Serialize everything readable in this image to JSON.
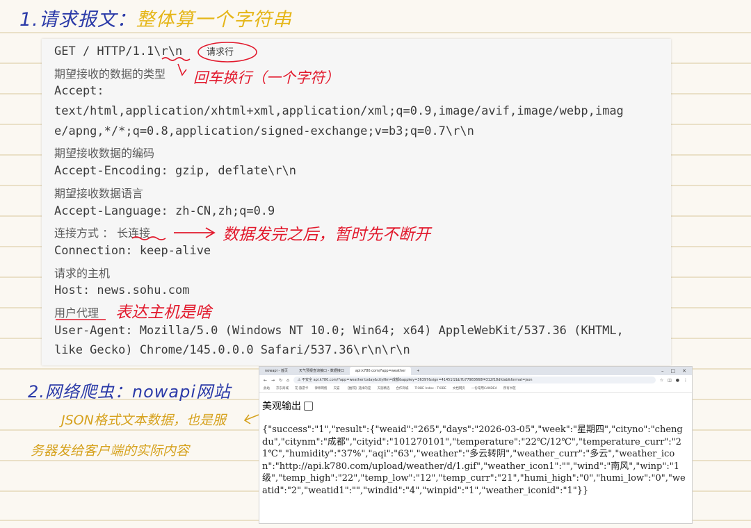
{
  "notes": {
    "title1_prefix": "1.请求报文：",
    "title1_accent": "整体算一个字符串",
    "annotation_request_line": "请求行",
    "annotation_crlf": "回车换行（一个字符）",
    "annotation_keepalive": "数据发完之后，暂时先不断开",
    "annotation_useragent": "表达主机是啥",
    "title2": "2.网络爬虫：nowapi网站",
    "gold_line1": "JSON格式文本数据，也是服",
    "gold_line2": "务器发给客户端的实际内容"
  },
  "http": {
    "request_line": "GET / HTTP/1.1\\r\\n",
    "cm_accept": "期望接收的数据的类型",
    "accept_key": "Accept:",
    "accept_value_1": "text/html,application/xhtml+xml,application/xml;q=0.9,image/avif,image/webp,imag",
    "accept_value_2": "e/apng,*/*;q=0.8,application/signed-exchange;v=b3;q=0.7\\r\\n",
    "cm_encoding": "期望接收数据的编码",
    "accept_encoding": "Accept-Encoding: gzip, deflate\\r\\n",
    "cm_language": "期望接收数据语言",
    "accept_language": "Accept-Language: zh-CN,zh;q=0.9",
    "cm_connection": "连接方式 ： 长连接",
    "connection": "Connection: keep-alive",
    "cm_host": "请求的主机",
    "host": "Host: news.sohu.com",
    "cm_useragent": "用户代理",
    "user_agent_1": "User-Agent: Mozilla/5.0 (Windows NT 10.0; Win64; x64) AppleWebKit/537.36 (KHTML,",
    "user_agent_2": "like Gecko) Chrome/145.0.0.0 Safari/537.36\\r\\n\\r\\n"
  },
  "browser": {
    "tabs": [
      "nowapi - 首页",
      "天气预报查询接口 - 数据接口",
      "api.k780.com/?app=weather"
    ],
    "new_tab": "+",
    "url": "api.k780.com/?app=weather.today&cityNm=成都&appkey=36397&sign=41451f2bb7b77983668f4312f18dfdab&format=json",
    "url_security": "不安全",
    "bookmarks": [
      "此站",
      "京东商城",
      "花·旅游卡",
      "律师网络",
      "天猫",
      "【推荐】选择的是",
      "天涯精选",
      "合作商城",
      "TIOBE Index - TIOBE",
      "文档网页",
      "一份常用CANDEA",
      "所有书签"
    ],
    "pretty_label": "美观输出",
    "json_text": "{\"success\":\"1\",\"result\":{\"weaid\":\"265\",\"days\":\"2026-03-05\",\"week\":\"星期四\",\"cityno\":\"chengdu\",\"citynm\":\"成都\",\"cityid\":\"101270101\",\"temperature\":\"22℃/12℃\",\"temperature_curr\":\"21℃\",\"humidity\":\"37%\",\"aqi\":\"63\",\"weather\":\"多云转阴\",\"weather_curr\":\"多云\",\"weather_icon\":\"http://api.k780.com/upload/weather/d/1.gif\",\"weather_icon1\":\"\",\"wind\":\"南风\",\"winp\":\"1级\",\"temp_high\":\"22\",\"temp_low\":\"12\",\"temp_curr\":\"21\",\"humi_high\":\"0\",\"humi_low\":\"0\",\"weatid\":\"2\",\"weatid1\":\"\",\"windid\":\"4\",\"winpid\":\"1\",\"weather_iconid\":\"1\"}}"
  },
  "colors": {
    "paper": "#fbf8f2",
    "rule": "#d9c79c",
    "blue_ink": "#2b3aa8",
    "red_ink": "#e2192c",
    "gold_ink": "#d6a21e"
  }
}
